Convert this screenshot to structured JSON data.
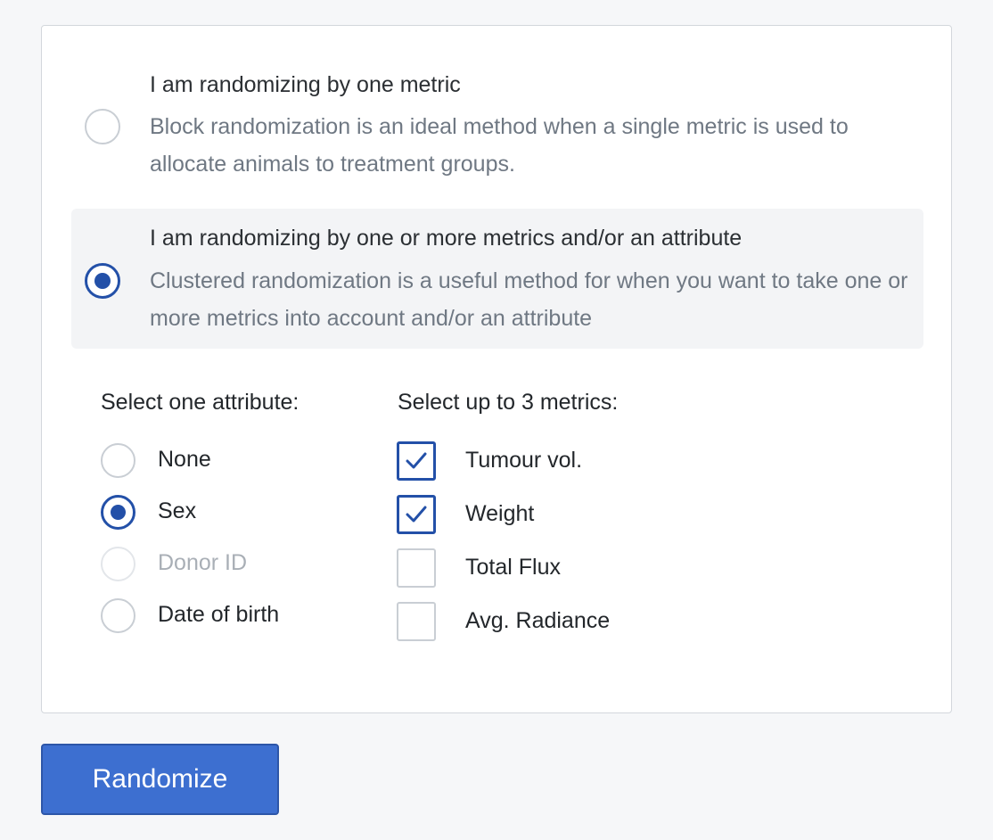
{
  "randomization_options": [
    {
      "title": "I am randomizing by one metric",
      "description": "Block randomization is an ideal method when a single metric is used to allocate animals to treatment groups.",
      "selected": false
    },
    {
      "title": "I am randomizing by one or more metrics and/or an attribute",
      "description": "Clustered randomization is a useful method for when you want to take one or more metrics into account and/or an attribute",
      "selected": true
    }
  ],
  "attributes": {
    "label": "Select one attribute:",
    "items": [
      {
        "label": "None",
        "selected": false,
        "disabled": false
      },
      {
        "label": "Sex",
        "selected": true,
        "disabled": false
      },
      {
        "label": "Donor ID",
        "selected": false,
        "disabled": true
      },
      {
        "label": "Date of birth",
        "selected": false,
        "disabled": false
      }
    ]
  },
  "metrics": {
    "label": "Select up to 3 metrics:",
    "items": [
      {
        "label": "Tumour vol.",
        "checked": true
      },
      {
        "label": "Weight",
        "checked": true
      },
      {
        "label": "Total Flux",
        "checked": false
      },
      {
        "label": "Avg. Radiance",
        "checked": false
      }
    ]
  },
  "randomize_button": {
    "label": "Randomize"
  },
  "colors": {
    "accent": "#2350a8",
    "button": "#3d6fd0",
    "selected_bg": "#f3f4f6",
    "page_bg": "#f6f7f9"
  }
}
